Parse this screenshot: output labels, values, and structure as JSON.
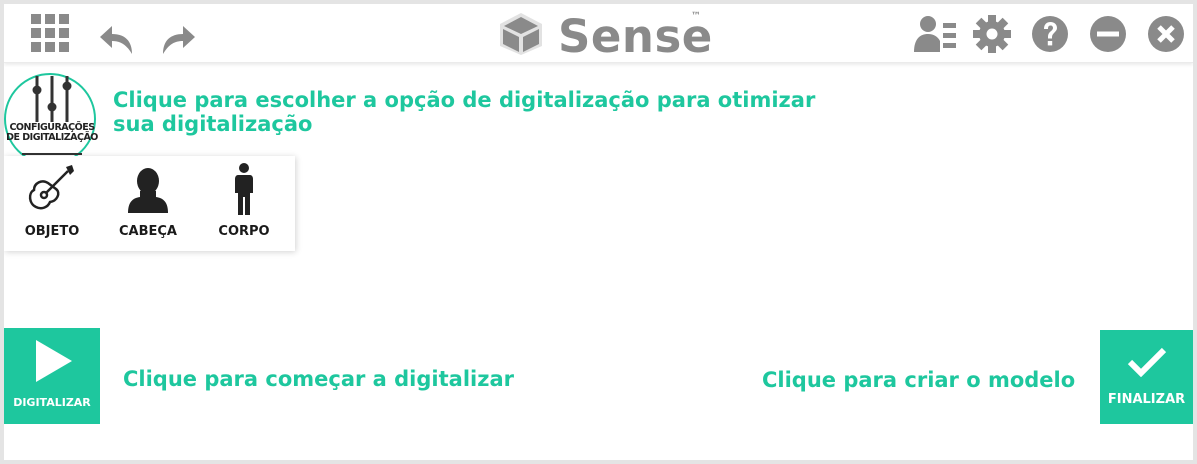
{
  "app": {
    "logo_text": "Sense",
    "logo_tm": "™"
  },
  "toolbar": {
    "left_icons": [
      "apps-grid-icon",
      "undo-icon",
      "redo-icon"
    ],
    "right_icons": [
      "user-list-icon",
      "gear-icon",
      "help-icon",
      "minimize-icon",
      "close-icon"
    ]
  },
  "settings": {
    "label_line1": "CONFIGURAÇÕES",
    "label_line2": "DE DIGITALIZAÇÃO",
    "icon": "sliders-icon"
  },
  "hints": {
    "settings": "Clique para escolher a opção de digitalização para otimizar",
    "settings_line2": "sua digitalização",
    "scan": "Clique para começar a digitalizar",
    "finish": "Clique para criar o modelo"
  },
  "modes": [
    {
      "label": "OBJETO",
      "icon": "guitar-icon"
    },
    {
      "label": "CABEÇA",
      "icon": "head-icon"
    },
    {
      "label": "CORPO",
      "icon": "body-icon"
    }
  ],
  "buttons": {
    "scan_label": "DIGITALIZAR",
    "finish_label": "FINALIZAR"
  },
  "colors": {
    "accent": "#1ec79e",
    "icon_gray": "#8a8a8a",
    "dark": "#333333"
  }
}
